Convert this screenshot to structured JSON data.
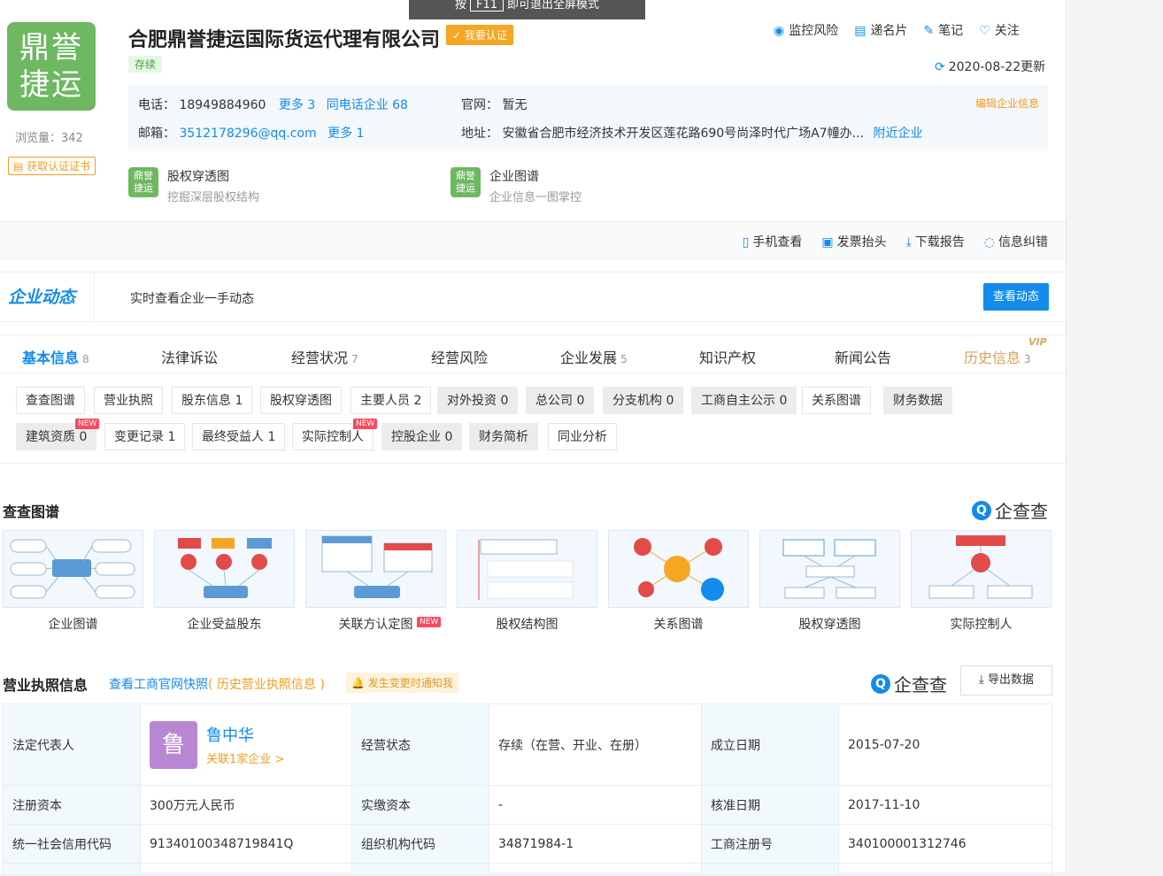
{
  "toast": {
    "pre": "按",
    "key": "F11",
    "post": "即可退出全屏模式"
  },
  "company": {
    "logo_line1": "鼎誉",
    "logo_line2": "捷运",
    "name": "合肥鼎誉捷运国际货运代理有限公司",
    "verify": "我要认证",
    "status": "存续",
    "views": "浏览量：342",
    "cert": "获取认证证书"
  },
  "top_actions": [
    "监控风险",
    "递名片",
    "笔记",
    "关注"
  ],
  "updated": "2020-08-22更新",
  "contact": {
    "phone_label": "电话：",
    "phone": "18949884960",
    "phone_more": "更多 3",
    "same_phone": "同电话企业 68",
    "email_label": "邮箱：",
    "email": "3512178296@qq.com",
    "email_more": "更多 1",
    "site_label": "官网：",
    "site": "暂无",
    "addr_label": "地址：",
    "addr": "安徽省合肥市经济技术开发区莲花路690号尚泽时代广场A7幢办...",
    "nearby": "附近企业",
    "edit": "编辑企业信息"
  },
  "tiles": [
    {
      "title": "股权穿透图",
      "sub": "挖掘深层股权结构"
    },
    {
      "title": "企业图谱",
      "sub": "企业信息一图掌控"
    }
  ],
  "bar_actions": [
    "手机查看",
    "发票抬头",
    "下载报告",
    "信息纠错"
  ],
  "dynamics": {
    "label": "企业动态",
    "text": "实时查看企业一手动态",
    "button": "查看动态"
  },
  "tabs": [
    {
      "label": "基本信息",
      "count": "8"
    },
    {
      "label": "法律诉讼",
      "count": ""
    },
    {
      "label": "经营状况",
      "count": "7"
    },
    {
      "label": "经营风险",
      "count": ""
    },
    {
      "label": "企业发展",
      "count": "5"
    },
    {
      "label": "知识产权",
      "count": ""
    },
    {
      "label": "新闻公告",
      "count": ""
    },
    {
      "label": "历史信息",
      "count": "3"
    }
  ],
  "vip": "VIP",
  "chips_row1": [
    "查查图谱",
    "营业执照",
    "股东信息 1",
    "股权穿透图",
    "主要人员 2",
    "对外投资 0",
    "总公司 0",
    "分支机构 0",
    "工商自主公示 0",
    "关系图谱",
    "财务数据"
  ],
  "chips_row2": [
    "建筑资质 0",
    "变更记录 1",
    "最终受益人 1",
    "实际控制人",
    "控股企业 0",
    "财务简析",
    "同业分析"
  ],
  "new_tag": "NEW",
  "graph_section": {
    "title": "查查图谱",
    "brand": "企查查",
    "cards": [
      "企业图谱",
      "企业受益股东",
      "关联方认定图",
      "股权结构图",
      "关系图谱",
      "股权穿透图",
      "实际控制人"
    ]
  },
  "license": {
    "title": "营业执照信息",
    "link": "查看工商官网快照",
    "history": "( 历史营业执照信息 )",
    "notify": "发生变更时通知我",
    "brand": "企查查",
    "export": "导出数据",
    "legal_label": "法定代表人",
    "legal_avatar": "鲁",
    "legal_name": "鲁中华",
    "legal_rel": "关联1家企业 >",
    "biz_status_label": "经营状态",
    "biz_status": "存续（在营、开业、在册）",
    "found_label": "成立日期",
    "found": "2015-07-20",
    "capital_label": "注册资本",
    "capital": "300万元人民币",
    "paid_label": "实缴资本",
    "paid": "-",
    "approve_label": "核准日期",
    "approve": "2017-11-10",
    "credit_label": "统一社会信用代码",
    "credit": "91340100348719841Q",
    "org_label": "组织机构代码",
    "org": "34871984-1",
    "reg_label": "工商注册号",
    "reg": "340100001312746"
  }
}
